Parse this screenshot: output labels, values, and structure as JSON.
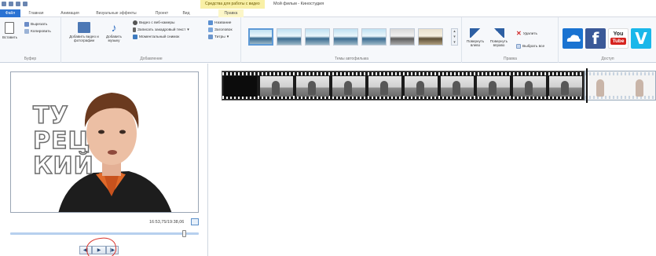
{
  "window": {
    "title": "Мой фильм - Киностудия",
    "context_tools": "Средства для работы с видео"
  },
  "tabs": [
    {
      "label": "Файл"
    },
    {
      "label": "Главная"
    },
    {
      "label": "Анимация"
    },
    {
      "label": "Визуальные эффекты"
    },
    {
      "label": "Проект"
    },
    {
      "label": "Вид"
    },
    {
      "label": "Правка"
    }
  ],
  "ribbon": {
    "clipboard": {
      "label": "Буфер",
      "paste": "Вставить",
      "cut": "Вырезать",
      "copy": "Копировать"
    },
    "add": {
      "label": "Добавление",
      "add_video_photo": "Добавить видео и фотографии",
      "add_music": "Добавить музыку",
      "webcam_video": "Видео с веб-камеры",
      "record_narration": "Записать закадровый текст",
      "snapshot": "Моментальный снимок",
      "title": "Название",
      "caption": "Заголовок",
      "credits": "Титры"
    },
    "themes": {
      "label": "Темы автофильма"
    },
    "edit": {
      "label": "Правка",
      "rotate_left": "Повернуть влево",
      "rotate_right": "Повернуть вправо",
      "delete": "Удалить",
      "select_all": "Выбрать все"
    },
    "share": {
      "label": "Доступ",
      "items": [
        "onedrive",
        "facebook",
        "youtube",
        "vimeo"
      ],
      "youtube_you": "You",
      "youtube_tube": "Tube"
    }
  },
  "preview": {
    "overlay_text": [
      "ТУ",
      "РЕЦ",
      "КИЙ"
    ],
    "timecode": "16:53,75/19:38,06",
    "seek_position": 0.93
  },
  "player": {
    "prev_icon": "◀|",
    "play_icon": "▶",
    "next_icon": "|▶"
  },
  "colors": {
    "file_tab": "#2b73d3",
    "context_highlight": "#f9f0a6",
    "annotation_circle": "#d9342b"
  }
}
